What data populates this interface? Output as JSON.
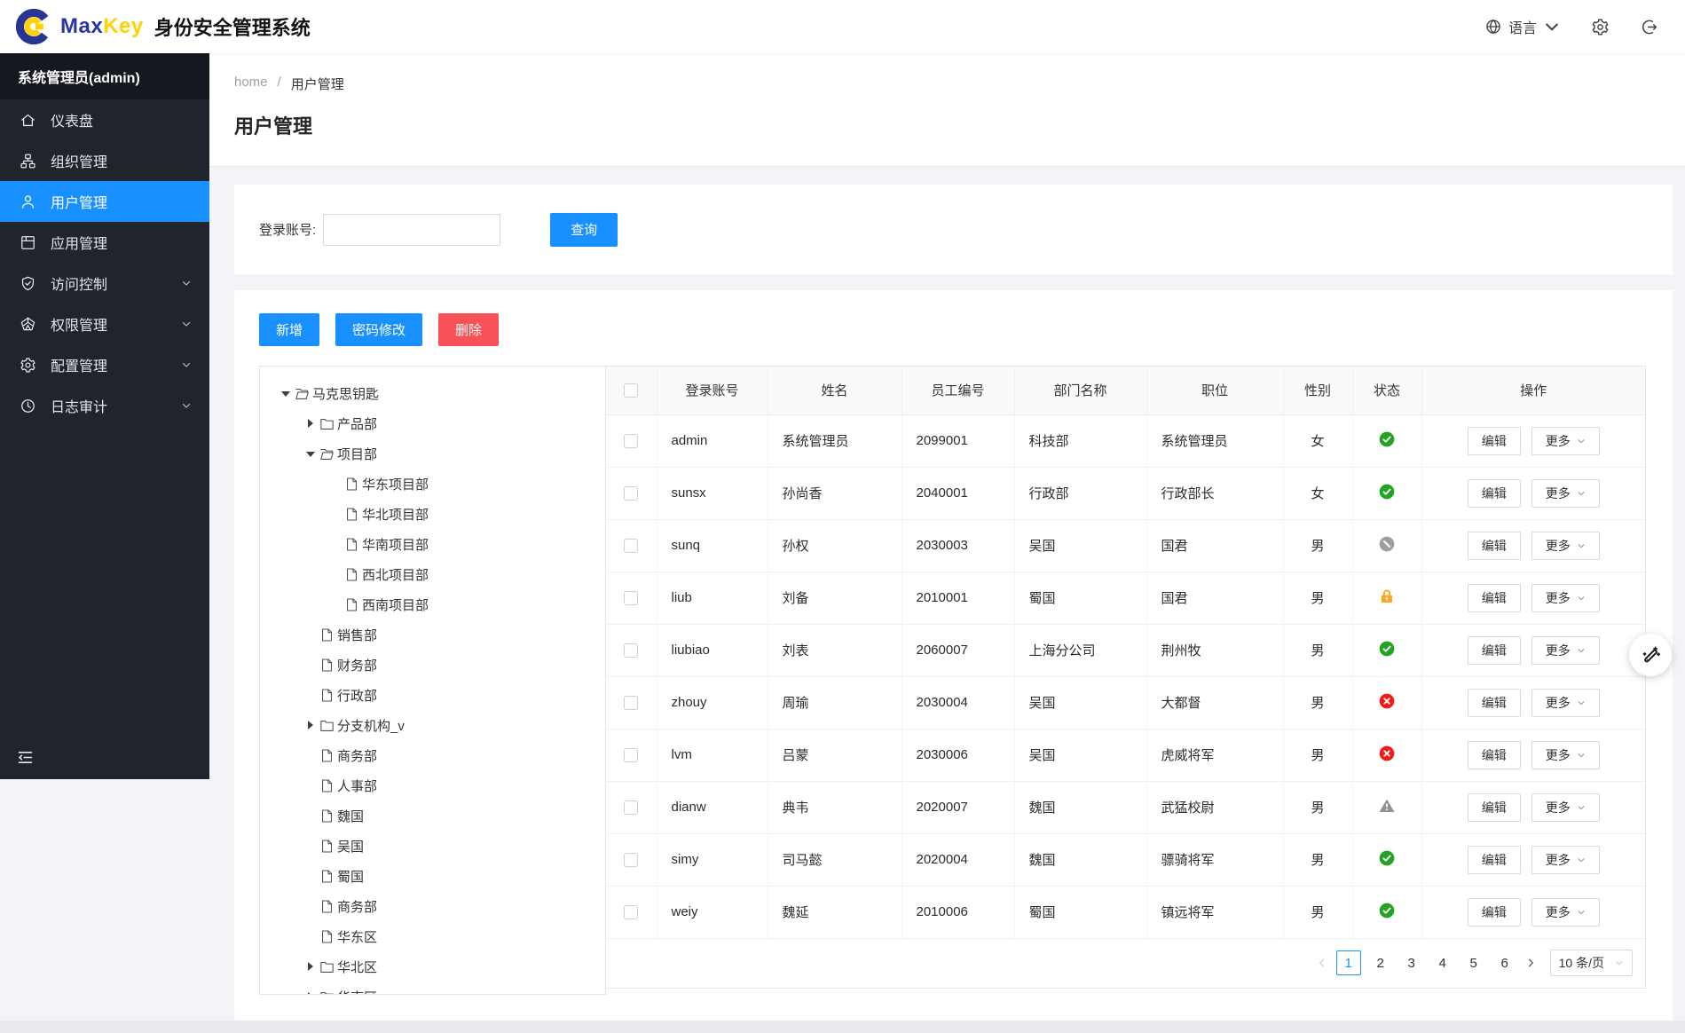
{
  "header": {
    "brand": {
      "max": "Max",
      "key": "Key",
      "suffix": "身份安全管理系统"
    },
    "language": {
      "icon": "globe",
      "label": "语言"
    },
    "settings_icon": "gear",
    "logout_icon": "logout"
  },
  "sidebar": {
    "user": "系统管理员(admin)",
    "items": [
      {
        "icon": "home",
        "label": "仪表盘",
        "active": false,
        "expandable": false
      },
      {
        "icon": "org",
        "label": "组织管理",
        "active": false,
        "expandable": false
      },
      {
        "icon": "user",
        "label": "用户管理",
        "active": true,
        "expandable": false
      },
      {
        "icon": "app",
        "label": "应用管理",
        "active": false,
        "expandable": false
      },
      {
        "icon": "shield",
        "label": "访问控制",
        "active": false,
        "expandable": true
      },
      {
        "icon": "gem",
        "label": "权限管理",
        "active": false,
        "expandable": true
      },
      {
        "icon": "config",
        "label": "配置管理",
        "active": false,
        "expandable": true
      },
      {
        "icon": "clock",
        "label": "日志审计",
        "active": false,
        "expandable": true
      }
    ],
    "collapse_icon": "menu-fold"
  },
  "breadcrumb": {
    "home": "home",
    "separator": "/",
    "current": "用户管理"
  },
  "page_title": "用户管理",
  "search": {
    "label": "登录账号:",
    "value": "",
    "button": "查询"
  },
  "toolbar": {
    "add": "新增",
    "change_password": "密码修改",
    "delete": "删除"
  },
  "tree": {
    "items": [
      {
        "label": "马克思钥匙",
        "level": 0,
        "caret": "down",
        "icon": "folder-open"
      },
      {
        "label": "产品部",
        "level": 1,
        "caret": "right",
        "icon": "folder"
      },
      {
        "label": "项目部",
        "level": 1,
        "caret": "down",
        "icon": "folder-open"
      },
      {
        "label": "华东项目部",
        "level": 2,
        "caret": "none",
        "icon": "file"
      },
      {
        "label": "华北项目部",
        "level": 2,
        "caret": "none",
        "icon": "file"
      },
      {
        "label": "华南项目部",
        "level": 2,
        "caret": "none",
        "icon": "file"
      },
      {
        "label": "西北项目部",
        "level": 2,
        "caret": "none",
        "icon": "file"
      },
      {
        "label": "西南项目部",
        "level": 2,
        "caret": "none",
        "icon": "file"
      },
      {
        "label": "销售部",
        "level": 1,
        "caret": "none",
        "icon": "file"
      },
      {
        "label": "财务部",
        "level": 1,
        "caret": "none",
        "icon": "file"
      },
      {
        "label": "行政部",
        "level": 1,
        "caret": "none",
        "icon": "file"
      },
      {
        "label": "分支机构_v",
        "level": 1,
        "caret": "right",
        "icon": "folder"
      },
      {
        "label": "商务部",
        "level": 1,
        "caret": "none",
        "icon": "file"
      },
      {
        "label": "人事部",
        "level": 1,
        "caret": "none",
        "icon": "file"
      },
      {
        "label": "魏国",
        "level": 1,
        "caret": "none",
        "icon": "file"
      },
      {
        "label": "吴国",
        "level": 1,
        "caret": "none",
        "icon": "file"
      },
      {
        "label": "蜀国",
        "level": 1,
        "caret": "none",
        "icon": "file"
      },
      {
        "label": "商务部",
        "level": 1,
        "caret": "none",
        "icon": "file"
      },
      {
        "label": "华东区",
        "level": 1,
        "caret": "none",
        "icon": "file"
      },
      {
        "label": "华北区",
        "level": 1,
        "caret": "right",
        "icon": "folder"
      },
      {
        "label": "华南区",
        "level": 1,
        "caret": "right",
        "icon": "folder"
      }
    ]
  },
  "table": {
    "columns": [
      "登录账号",
      "姓名",
      "员工编号",
      "部门名称",
      "职位",
      "性别",
      "状态",
      "操作"
    ],
    "actions": {
      "edit": "编辑",
      "more": "更多"
    },
    "rows": [
      {
        "login": "admin",
        "name": "系统管理员",
        "employee_no": "2099001",
        "department": "科技部",
        "position": "系统管理员",
        "gender": "女",
        "status": "active"
      },
      {
        "login": "sunsx",
        "name": "孙尚香",
        "employee_no": "2040001",
        "department": "行政部",
        "position": "行政部长",
        "gender": "女",
        "status": "active"
      },
      {
        "login": "sunq",
        "name": "孙权",
        "employee_no": "2030003",
        "department": "吴国",
        "position": "国君",
        "gender": "男",
        "status": "disabled"
      },
      {
        "login": "liub",
        "name": "刘备",
        "employee_no": "2010001",
        "department": "蜀国",
        "position": "国君",
        "gender": "男",
        "status": "locked"
      },
      {
        "login": "liubiao",
        "name": "刘表",
        "employee_no": "2060007",
        "department": "上海分公司",
        "position": "荆州牧",
        "gender": "男",
        "status": "active"
      },
      {
        "login": "zhouy",
        "name": "周瑜",
        "employee_no": "2030004",
        "department": "吴国",
        "position": "大都督",
        "gender": "男",
        "status": "inactive"
      },
      {
        "login": "lvm",
        "name": "吕蒙",
        "employee_no": "2030006",
        "department": "吴国",
        "position": "虎威将军",
        "gender": "男",
        "status": "inactive"
      },
      {
        "login": "dianw",
        "name": "典韦",
        "employee_no": "2020007",
        "department": "魏国",
        "position": "武猛校尉",
        "gender": "男",
        "status": "warning"
      },
      {
        "login": "simy",
        "name": "司马懿",
        "employee_no": "2020004",
        "department": "魏国",
        "position": "骠骑将军",
        "gender": "男",
        "status": "active"
      },
      {
        "login": "weiy",
        "name": "魏延",
        "employee_no": "2010006",
        "department": "蜀国",
        "position": "镇远将军",
        "gender": "男",
        "status": "active"
      }
    ]
  },
  "status_styles": {
    "active": {
      "icon": "check-circle",
      "color": "#23a223"
    },
    "disabled": {
      "icon": "ban-circle",
      "color": "#9d9fa3"
    },
    "locked": {
      "icon": "lock",
      "color": "#ffa71e"
    },
    "inactive": {
      "icon": "x-circle",
      "color": "#f11a1a"
    },
    "warning": {
      "icon": "warning-triangle",
      "color": "#8f9398"
    }
  },
  "pagination": {
    "pages": [
      "1",
      "2",
      "3",
      "4",
      "5",
      "6"
    ],
    "current": "1",
    "page_size": "10 条/页"
  },
  "colors": {
    "primary": "#1890ff",
    "danger": "#f85157",
    "sidebar": "#20242d",
    "sidebar_header": "#16181f"
  },
  "floating_button": {
    "icon": "magic-wand"
  }
}
